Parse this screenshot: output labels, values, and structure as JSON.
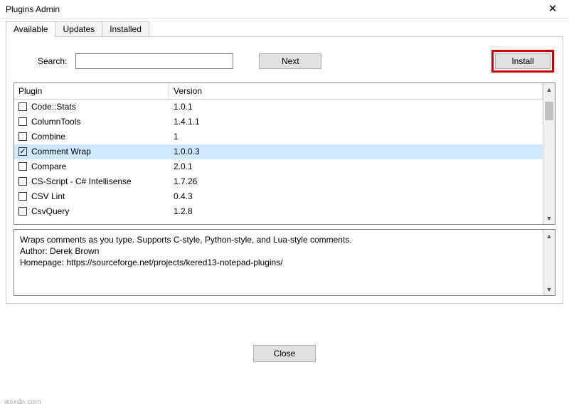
{
  "window": {
    "title": "Plugins Admin",
    "close_symbol": "✕"
  },
  "tabs": [
    {
      "label": "Available",
      "active": true
    },
    {
      "label": "Updates",
      "active": false
    },
    {
      "label": "Installed",
      "active": false
    }
  ],
  "toolbar": {
    "search_label": "Search:",
    "search_value": "",
    "next_label": "Next",
    "install_label": "Install"
  },
  "table": {
    "headers": {
      "plugin": "Plugin",
      "version": "Version"
    },
    "rows": [
      {
        "name": "Code::Stats",
        "version": "1.0.1",
        "checked": false,
        "selected": false
      },
      {
        "name": "ColumnTools",
        "version": "1.4.1.1",
        "checked": false,
        "selected": false
      },
      {
        "name": "Combine",
        "version": "1",
        "checked": false,
        "selected": false
      },
      {
        "name": "Comment Wrap",
        "version": "1.0.0.3",
        "checked": true,
        "selected": true
      },
      {
        "name": "Compare",
        "version": "2.0.1",
        "checked": false,
        "selected": false
      },
      {
        "name": "CS-Script - C# Intellisense",
        "version": "1.7.26",
        "checked": false,
        "selected": false
      },
      {
        "name": "CSV Lint",
        "version": "0.4.3",
        "checked": false,
        "selected": false
      },
      {
        "name": "CsvQuery",
        "version": "1.2.8",
        "checked": false,
        "selected": false
      }
    ]
  },
  "description": {
    "text": "Wraps comments as you type. Supports C-style, Python-style, and Lua-style comments.\nAuthor: Derek Brown\nHomepage: https://sourceforge.net/projects/kered13-notepad-plugins/"
  },
  "footer": {
    "close_label": "Close"
  },
  "watermark": "wsxdn.com"
}
